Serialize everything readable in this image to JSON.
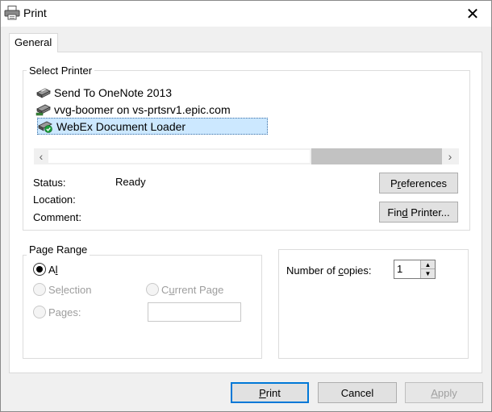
{
  "window": {
    "title": "Print",
    "close_glyph": "✕"
  },
  "tabs": [
    {
      "label": "General"
    }
  ],
  "select_printer": {
    "label": "Select Printer",
    "printers": [
      {
        "name": "Send To OneNote 2013",
        "icon": "printer-icon",
        "selected": false
      },
      {
        "name": "vvg-boomer on vs-prtsrv1.epic.com",
        "icon": "network-printer-icon",
        "selected": false
      },
      {
        "name": "WebEx Document Loader",
        "icon": "default-printer-icon",
        "selected": true
      }
    ],
    "status_label": "Status:",
    "status_value": "Ready",
    "location_label": "Location:",
    "location_value": "",
    "comment_label": "Comment:",
    "comment_value": "",
    "preferences_prefix": "P",
    "preferences_mnemonic": "r",
    "preferences_rest": "eferences",
    "find_printer_prefix": "Fin",
    "find_printer_mnemonic": "d",
    "find_printer_rest": " Printer..."
  },
  "page_range": {
    "label": "Page Range",
    "all_label": "All",
    "all_mnemonic": "l",
    "all_prefix": "A",
    "all_suffix": "l",
    "selection_prefix": "Se",
    "selection_mnemonic": "l",
    "selection_rest": "ection",
    "current_prefix": "C",
    "current_mnemonic": "u",
    "current_rest": "rrent Page",
    "pages_prefix": "Pa",
    "pages_mnemonic": "g",
    "pages_rest": "es:",
    "pages_value": "",
    "selected": "All"
  },
  "copies": {
    "label_prefix": "Number of ",
    "label_mnemonic": "c",
    "label_rest": "opies:",
    "value": "1"
  },
  "footer": {
    "print_mnemonic": "P",
    "print_rest": "rint",
    "cancel_label": "Cancel",
    "apply_mnemonic": "A",
    "apply_rest": "pply"
  }
}
